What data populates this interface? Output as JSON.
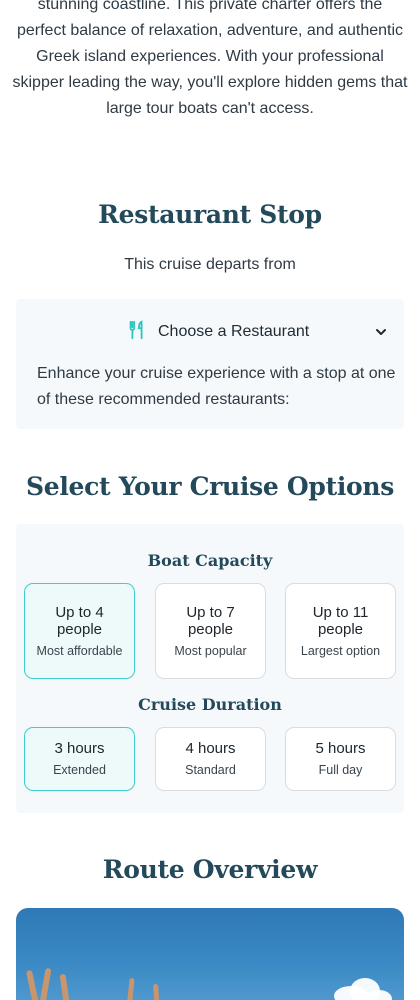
{
  "intro": {
    "text": "stunning coastline. This private charter offers the perfect balance of relaxation, adventure, and authentic Greek island experiences. With your professional skipper leading the way, you'll explore hidden gems that large tour boats can't access."
  },
  "restaurant_stop": {
    "title": "Restaurant Stop",
    "departs_text": "This cruise departs from",
    "toggle_label": "Choose a Restaurant",
    "toggle_icon": "fork-knife-icon",
    "description": "Enhance your cruise experience with a stop at one of these recommended restaurants:"
  },
  "cruise_options": {
    "title": "Select Your Cruise Options",
    "capacity": {
      "heading": "Boat Capacity",
      "options": [
        {
          "label": "Up to 4 people",
          "note": "Most affordable",
          "selected": true
        },
        {
          "label": "Up to 7 people",
          "note": "Most popular",
          "selected": false
        },
        {
          "label": "Up to 11 people",
          "note": "Largest option",
          "selected": false
        }
      ]
    },
    "duration": {
      "heading": "Cruise Duration",
      "options": [
        {
          "label": "3 hours",
          "note": "Extended",
          "selected": true
        },
        {
          "label": "4 hours",
          "note": "Standard",
          "selected": false
        },
        {
          "label": "5 hours",
          "note": "Full day",
          "selected": false
        }
      ]
    }
  },
  "route": {
    "title": "Route Overview"
  },
  "colors": {
    "accent": "#3ccfcb",
    "heading": "#23495a",
    "card_bg": "#f6f9fb"
  }
}
